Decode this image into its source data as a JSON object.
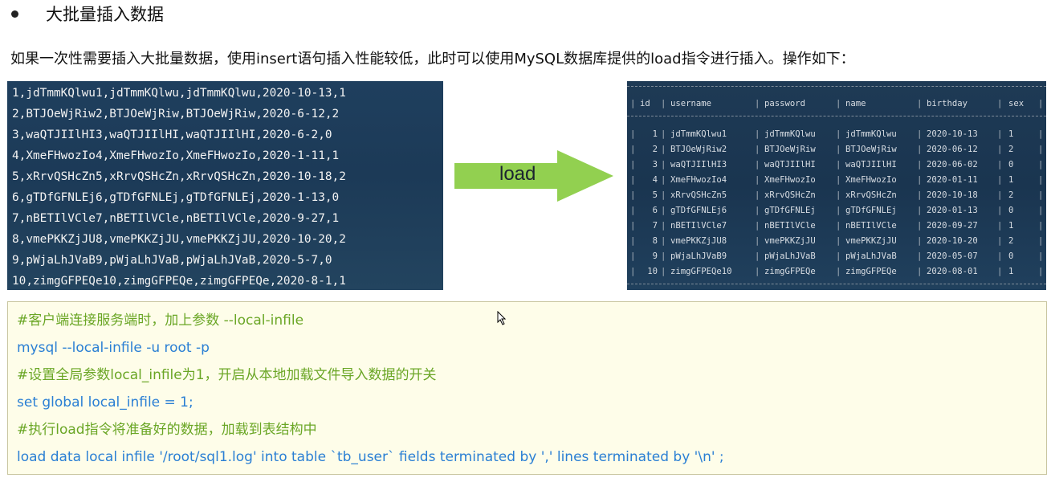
{
  "heading": "大批量插入数据",
  "intro": "如果一次性需要插入大批量数据，使用insert语句插入性能较低，此时可以使用MySQL数据库提供的load指令进行插入。操作如下：",
  "source_lines": [
    "1,jdTmmKQlwu1,jdTmmKQlwu,jdTmmKQlwu,2020-10-13,1",
    "2,BTJOeWjRiw2,BTJOeWjRiw,BTJOeWjRiw,2020-6-12,2",
    "3,waQTJIIlHI3,waQTJIIlHI,waQTJIIlHI,2020-6-2,0",
    "4,XmeFHwozIo4,XmeFHwozIo,XmeFHwozIo,2020-1-11,1",
    "5,xRrvQSHcZn5,xRrvQSHcZn,xRrvQSHcZn,2020-10-18,2",
    "6,gTDfGFNLEj6,gTDfGFNLEj,gTDfGFNLEj,2020-1-13,0",
    "7,nBETIlVCle7,nBETIlVCle,nBETIlVCle,2020-9-27,1",
    "8,vmePKKZjJU8,vmePKKZjJU,vmePKKZjJU,2020-10-20,2",
    "9,pWjaLhJVaB9,pWjaLhJVaB,pWjaLhJVaB,2020-5-7,0",
    "10,zimgGFPEQe10,zimgGFPEQe,zimgGFPEQe,2020-8-1,1"
  ],
  "arrow_label": "load",
  "result_table": {
    "columns": [
      "id",
      "username",
      "password",
      "name",
      "birthday",
      "sex"
    ],
    "rows": [
      [
        "1",
        "jdTmmKQlwu1",
        "jdTmmKQlwu",
        "jdTmmKQlwu",
        "2020-10-13",
        "1"
      ],
      [
        "2",
        "BTJOeWjRiw2",
        "BTJOeWjRiw",
        "BTJOeWjRiw",
        "2020-06-12",
        "2"
      ],
      [
        "3",
        "waQTJIIlHI3",
        "waQTJIIlHI",
        "waQTJIIlHI",
        "2020-06-02",
        "0"
      ],
      [
        "4",
        "XmeFHwozIo4",
        "XmeFHwozIo",
        "XmeFHwozIo",
        "2020-01-11",
        "1"
      ],
      [
        "5",
        "xRrvQSHcZn5",
        "xRrvQSHcZn",
        "xRrvQSHcZn",
        "2020-10-18",
        "2"
      ],
      [
        "6",
        "gTDfGFNLEj6",
        "gTDfGFNLEj",
        "gTDfGFNLEj",
        "2020-01-13",
        "0"
      ],
      [
        "7",
        "nBETIlVCle7",
        "nBETIlVCle",
        "nBETIlVCle",
        "2020-09-27",
        "1"
      ],
      [
        "8",
        "vmePKKZjJU8",
        "vmePKKZjJU",
        "vmePKKZjJU",
        "2020-10-20",
        "2"
      ],
      [
        "9",
        "pWjaLhJVaB9",
        "pWjaLhJVaB",
        "pWjaLhJVaB",
        "2020-05-07",
        "0"
      ],
      [
        "10",
        "zimgGFPEQe10",
        "zimgGFPEQe",
        "zimgGFPEQe",
        "2020-08-01",
        "1"
      ]
    ]
  },
  "code": {
    "line1": "#客户端连接服务端时，加上参数 --local-infile",
    "line2": "mysql --local-infile -u root -p",
    "line3": "#设置全局参数local_infile为1，开启从本地加载文件导入数据的开关",
    "line4": "set global local_infile = 1;",
    "line5": "#执行load指令将准备好的数据，加载到表结构中",
    "line6": "load data local infile '/root/sql1.log' into table `tb_user` fields terminated by ',' lines terminated by '\\n' ;"
  },
  "colors": {
    "comment": "#6aa625",
    "command": "#2a7fd4",
    "arrow": "#92d050",
    "code_bg": "#fefde9",
    "panel_bg": "#1c3a57"
  }
}
